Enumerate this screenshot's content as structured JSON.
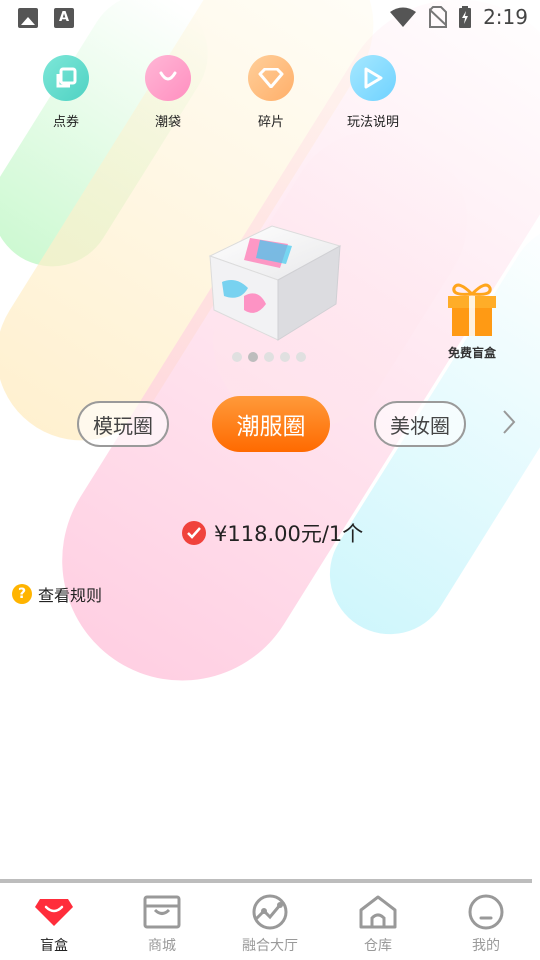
{
  "status_bar": {
    "time": "2:19",
    "icons": [
      "image-icon",
      "font-icon",
      "wifi-icon",
      "no-sim-icon",
      "battery-charging-icon"
    ],
    "font_icon_glyph": "A"
  },
  "quick_actions": [
    {
      "label": "点券",
      "icon": "ticket-icon",
      "color": "#5cd9c9"
    },
    {
      "label": "潮袋",
      "icon": "bag-icon",
      "color": "#ff9fc8"
    },
    {
      "label": "碎片",
      "icon": "diamond-icon",
      "color": "#ffbb80"
    },
    {
      "label": "玩法说明",
      "icon": "play-icon",
      "color": "#86dcff"
    }
  ],
  "banner": {
    "product_icon": "blind-box-product-image",
    "dots_total": 5,
    "dots_active_index": 1
  },
  "free_box": {
    "label": "免费盲盒",
    "icon": "gift-icon"
  },
  "categories": {
    "items": [
      "模玩圈",
      "潮服圈",
      "美妆圈"
    ],
    "selected": "潮服圈",
    "next_icon": "chevron-right-icon"
  },
  "price": {
    "text": "¥118.00元/1个",
    "icon": "check-circle-icon"
  },
  "rules": {
    "text": "查看规则",
    "icon": "question-circle-icon"
  },
  "tabbar": {
    "tabs": [
      {
        "label": "盲盒",
        "icon": "gem-icon",
        "active": true
      },
      {
        "label": "商城",
        "icon": "store-icon",
        "active": false
      },
      {
        "label": "融合大厅",
        "icon": "fusion-icon",
        "active": false
      },
      {
        "label": "仓库",
        "icon": "home-icon",
        "active": false
      },
      {
        "label": "我的",
        "icon": "profile-icon",
        "active": false
      }
    ],
    "active_color": "#ff2d3b",
    "inactive_color": "#9a9a9a"
  }
}
